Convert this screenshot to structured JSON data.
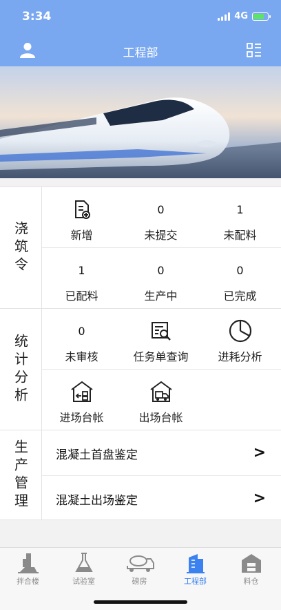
{
  "status": {
    "time": "3:34",
    "network": "4G",
    "battery_level": 0.8
  },
  "header": {
    "title": "工程部",
    "left_icon": "user-icon",
    "right_icon": "grid-menu-icon"
  },
  "banner": {
    "image": "high-speed-train-photo"
  },
  "pour": {
    "label": "浇筑令",
    "items": [
      {
        "icon": "document-add-icon",
        "label": "新增"
      },
      {
        "value": "0",
        "label": "未提交"
      },
      {
        "value": "1",
        "label": "未配料"
      },
      {
        "value": "1",
        "label": "已配料"
      },
      {
        "value": "0",
        "label": "生产中"
      },
      {
        "value": "0",
        "label": "已完成"
      }
    ]
  },
  "stats": {
    "label": "统计分析",
    "items": [
      {
        "value": "0",
        "label": "未审核"
      },
      {
        "icon": "report-search-icon",
        "label": "任务单查询"
      },
      {
        "icon": "pie-chart-icon",
        "label": "进耗分析"
      },
      {
        "icon": "warehouse-in-icon",
        "label": "进场台帐"
      },
      {
        "icon": "warehouse-truck-icon",
        "label": "出场台帐"
      }
    ]
  },
  "production": {
    "label": "生产管理",
    "rows": [
      {
        "label": "混凝土首盘鉴定",
        "arrow": ">"
      },
      {
        "label": "混凝土出场鉴定",
        "arrow": ">"
      }
    ]
  },
  "tabs": [
    {
      "label": "拌合楼",
      "icon": "mixing-plant-icon",
      "active": false
    },
    {
      "label": "试验室",
      "icon": "flask-icon",
      "active": false
    },
    {
      "label": "磅房",
      "icon": "mixer-truck-icon",
      "active": false
    },
    {
      "label": "工程部",
      "icon": "building-icon",
      "active": true
    },
    {
      "label": "料仓",
      "icon": "silo-icon",
      "active": false
    }
  ],
  "colors": {
    "header": "#7aa8f0",
    "active_tab": "#3b82f0",
    "inactive_tab": "#8a8a8a"
  }
}
